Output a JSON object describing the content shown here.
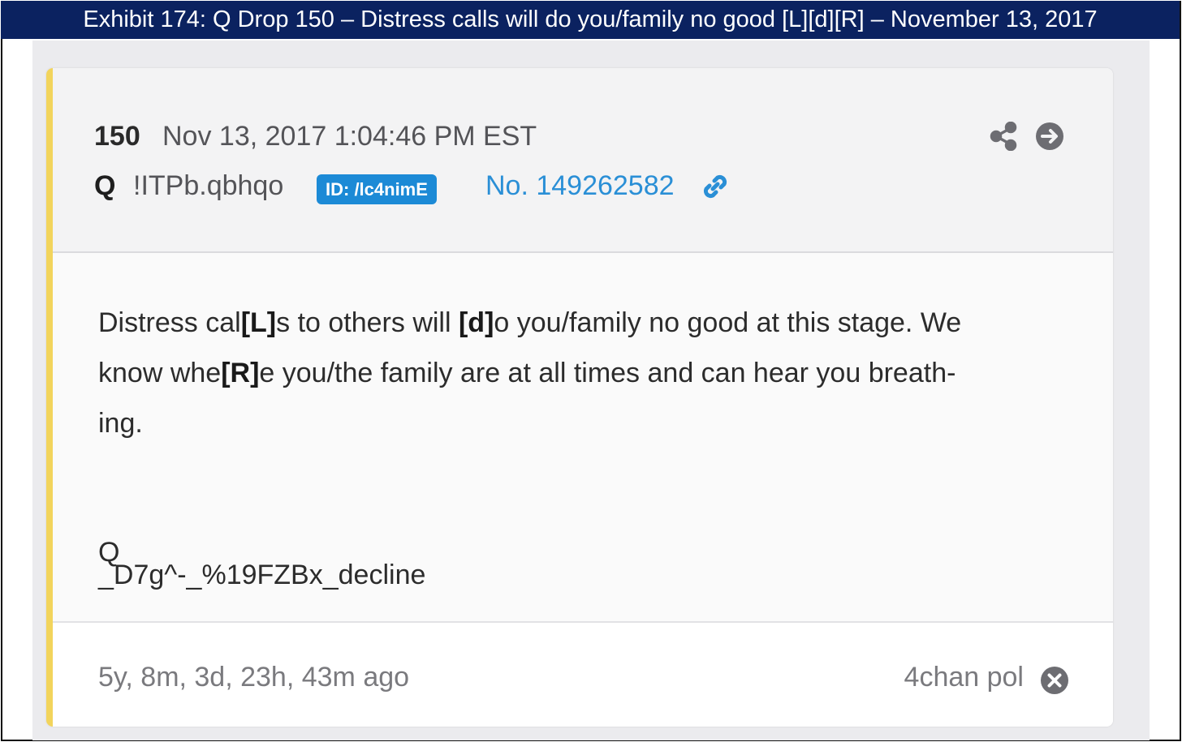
{
  "exhibit": {
    "title": "Exhibit 174: Q Drop 150 – Distress calls will do you/family no good [L][d][R] – November 13, 2017"
  },
  "post": {
    "number": "150",
    "date": "Nov 13, 2017 1:04:46 PM EST",
    "author": "Q",
    "tripcode": "!ITPb.qbhqo",
    "id_badge": "ID: /lc4nimE",
    "post_link": "No. 149262582",
    "body": {
      "line1": {
        "a": "Distress cal",
        "b1": "[L]",
        "c": "s to others will ",
        "b2": "[d]",
        "d": "o you/family no good at this stage. We"
      },
      "line2": {
        "a": "know whe",
        "b1": "[R]",
        "c": "e you/the family are at all times and can hear you breath-"
      },
      "line3": "ing.",
      "signature": "Q",
      "code": "_D7g^-_%19FZBx_decline"
    },
    "age": "5y, 8m, 3d, 23h, 43m ago",
    "source": "4chan pol"
  },
  "icons": {
    "share": "share-icon",
    "open": "arrow-right-circle-icon",
    "link": "link-icon",
    "close": "close-circle-icon"
  },
  "colors": {
    "banner": "#0b2260",
    "accent": "#f2d45c",
    "badge": "#1c8ad6",
    "link": "#2a8fd6"
  }
}
